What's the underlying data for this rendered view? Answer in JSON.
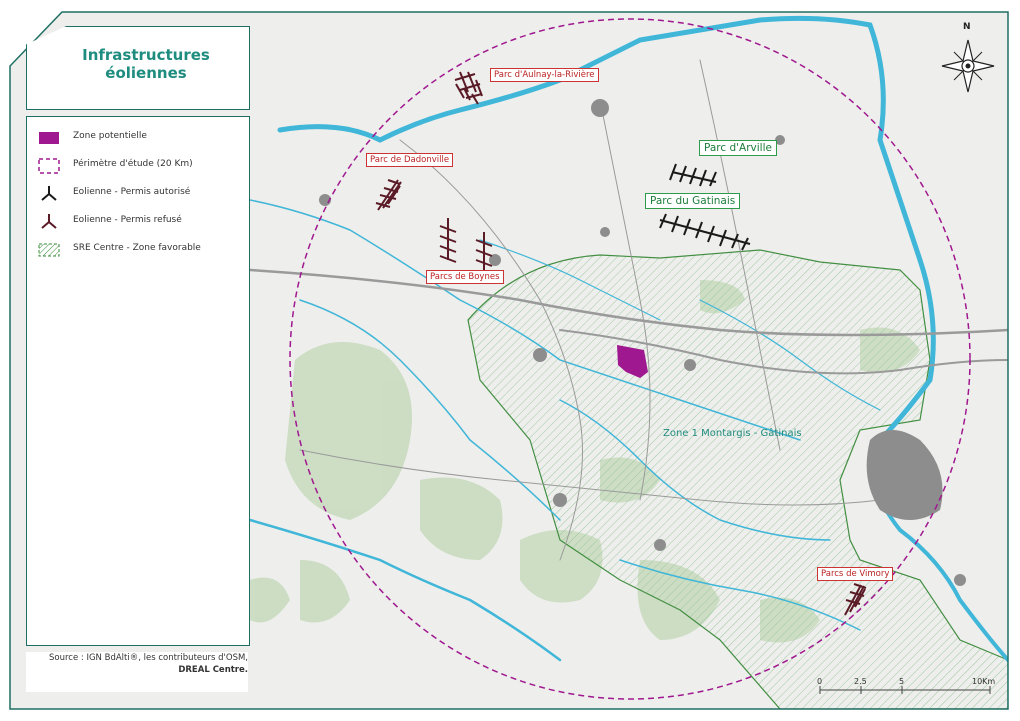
{
  "title": {
    "line1": "Infrastructures",
    "line2": "éoliennes"
  },
  "legend": {
    "items": [
      {
        "label": "Zone potentielle",
        "symbol": "purple-fill"
      },
      {
        "label": "Périmètre d'étude (20 Km)",
        "symbol": "dashed-circle"
      },
      {
        "label": "Eolienne - Permis autorisé",
        "symbol": "black-turbine"
      },
      {
        "label": "Eolienne - Permis refusé",
        "symbol": "red-turbine"
      },
      {
        "label": "SRE Centre - Zone favorable",
        "symbol": "hatched-green"
      }
    ]
  },
  "source": {
    "line1": "Source : IGN BdAlti®, les contributeurs d'OSM,",
    "line2": "DREAL Centre."
  },
  "parks": {
    "aulnay": "Parc d'Aulnay-la-Rivière",
    "dadonville": "Parc de Dadonville",
    "boynes": "Parcs de Boynes",
    "arville": "Parc d'Arville",
    "gatinais": "Parc du Gatinais",
    "vimory": "Parcs de Vimory"
  },
  "zone_label": "Zone 1 Montargis - Gâtinais",
  "compass": {
    "north": "N"
  },
  "scale": {
    "t0": "0",
    "t1": "2.5",
    "t2": "5",
    "t3": "10Km"
  },
  "colors": {
    "frame": "#1e6f63",
    "potential_zone": "#a0188f",
    "study_perimeter": "#a0188f",
    "favorable_zone": "#3a8a3a",
    "water": "#40b6d8",
    "refused_turbine": "#5a1a26",
    "authorized_turbine": "#1a1a1a"
  }
}
